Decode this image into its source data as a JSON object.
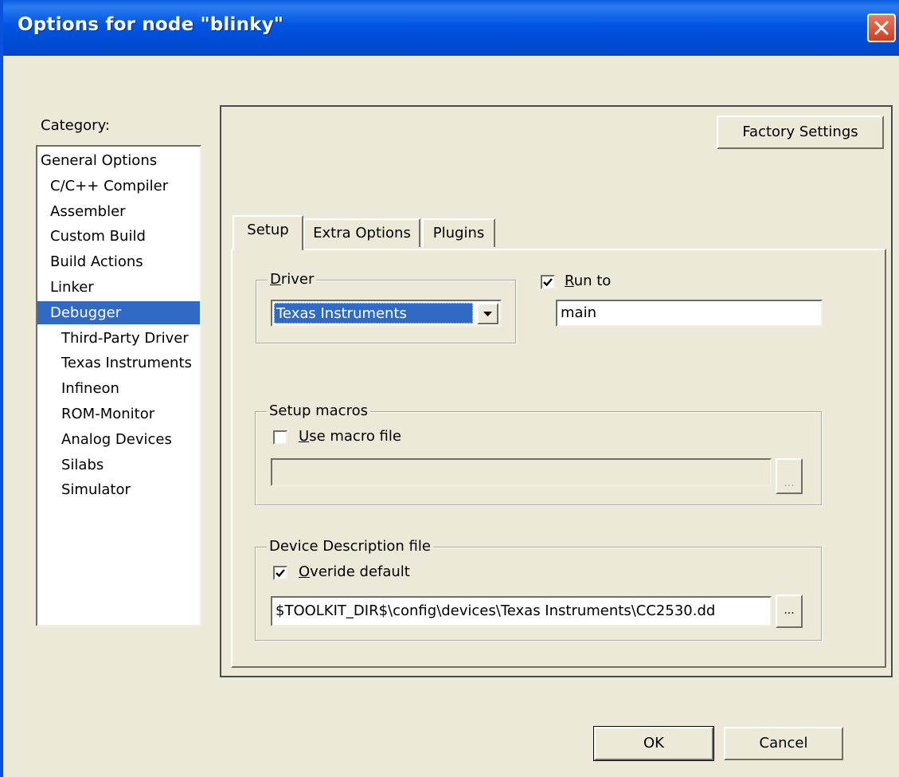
{
  "window": {
    "title": "Options for node \"blinky\""
  },
  "category": {
    "label": "Category:",
    "selected_index": 6,
    "items": [
      {
        "label": "General Options",
        "indent": 0
      },
      {
        "label": "C/C++ Compiler",
        "indent": 1
      },
      {
        "label": "Assembler",
        "indent": 1
      },
      {
        "label": "Custom Build",
        "indent": 1
      },
      {
        "label": "Build Actions",
        "indent": 1
      },
      {
        "label": "Linker",
        "indent": 1
      },
      {
        "label": "Debugger",
        "indent": 1
      },
      {
        "label": "Third-Party Driver",
        "indent": 2
      },
      {
        "label": "Texas Instruments",
        "indent": 2
      },
      {
        "label": "Infineon",
        "indent": 2
      },
      {
        "label": "ROM-Monitor",
        "indent": 2
      },
      {
        "label": "Analog Devices",
        "indent": 2
      },
      {
        "label": "Silabs",
        "indent": 2
      },
      {
        "label": "Simulator",
        "indent": 2
      }
    ]
  },
  "factory_settings_label": "Factory Settings",
  "tabs": [
    {
      "label": "Setup",
      "active": true
    },
    {
      "label": "Extra Options",
      "active": false
    },
    {
      "label": "Plugins",
      "active": false
    }
  ],
  "driver": {
    "group_label_first": "D",
    "group_label_rest": "river",
    "selected": "Texas Instruments"
  },
  "run_to": {
    "checked": true,
    "label_first": "R",
    "label_rest": "un to",
    "value": "main"
  },
  "setup_macros": {
    "group_label": "Setup macros",
    "checked": false,
    "label_first": "U",
    "label_rest": "se macro file",
    "value": "",
    "browse_label": "..."
  },
  "device_description": {
    "group_label": "Device Description file",
    "checked": true,
    "label_first": "O",
    "label_rest": "veride default",
    "value": "$TOOLKIT_DIR$\\config\\devices\\Texas Instruments\\CC2530.dd",
    "browse_label": "..."
  },
  "ok_label": "OK",
  "cancel_label": "Cancel",
  "colors": {
    "titlebar": "#0054e3",
    "selection": "#316ac5",
    "face": "#ece9d8",
    "close": "#d9573a"
  }
}
